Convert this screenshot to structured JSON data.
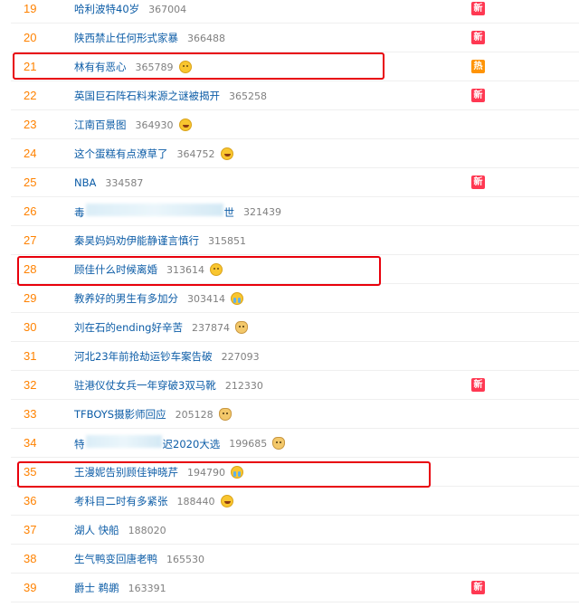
{
  "rows": [
    {
      "rank": "19",
      "title": "哈利波特40岁",
      "count": "367004",
      "emoji": "",
      "badge": "新"
    },
    {
      "rank": "20",
      "title": "陕西禁止任何形式家暴",
      "count": "366488",
      "emoji": "",
      "badge": "新"
    },
    {
      "rank": "21",
      "title": "林有有恶心",
      "count": "365789",
      "emoji": "face",
      "badge": "热"
    },
    {
      "rank": "22",
      "title": "英国巨石阵石料来源之谜被揭开",
      "count": "365258",
      "emoji": "",
      "badge": "新"
    },
    {
      "rank": "23",
      "title": "江南百景图",
      "count": "364930",
      "emoji": "laugh",
      "badge": ""
    },
    {
      "rank": "24",
      "title": "这个蛋糕有点潦草了",
      "count": "364752",
      "emoji": "laugh",
      "badge": ""
    },
    {
      "rank": "25",
      "title": "NBA",
      "count": "334587",
      "emoji": "",
      "badge": "新"
    },
    {
      "rank": "26",
      "title_prefix": "毒",
      "title_suffix": "世",
      "count": "321439",
      "emoji": "",
      "badge": ""
    },
    {
      "rank": "27",
      "title": "秦昊妈妈劝伊能静谨言慎行",
      "count": "315851",
      "emoji": "",
      "badge": ""
    },
    {
      "rank": "28",
      "title": "顾佳什么时候离婚",
      "count": "313614",
      "emoji": "face",
      "badge": ""
    },
    {
      "rank": "29",
      "title": "教养好的男生有多加分",
      "count": "303414",
      "emoji": "cry",
      "badge": ""
    },
    {
      "rank": "30",
      "title": "刘在石的ending好辛苦",
      "count": "237874",
      "emoji": "doge",
      "badge": ""
    },
    {
      "rank": "31",
      "title": "河北23年前抢劫运钞车案告破",
      "count": "227093",
      "emoji": "",
      "badge": ""
    },
    {
      "rank": "32",
      "title": "驻港仪仗女兵一年穿破3双马靴",
      "count": "212330",
      "emoji": "",
      "badge": "新"
    },
    {
      "rank": "33",
      "title": "TFBOYS摄影师回应",
      "count": "205128",
      "emoji": "doge",
      "badge": ""
    },
    {
      "rank": "34",
      "title_prefix": "特",
      "title_suffix": "迟2020大选",
      "count": "199685",
      "emoji": "doge",
      "badge": ""
    },
    {
      "rank": "35",
      "title": "王漫妮告别顾佳钟晓芹",
      "count": "194790",
      "emoji": "cry",
      "badge": ""
    },
    {
      "rank": "36",
      "title": "考科目二时有多紧张",
      "count": "188440",
      "emoji": "laugh",
      "badge": ""
    },
    {
      "rank": "37",
      "title": "湖人 快船",
      "count": "188020",
      "emoji": "",
      "badge": ""
    },
    {
      "rank": "38",
      "title": "生气鸭变回唐老鸭",
      "count": "165530",
      "emoji": "",
      "badge": ""
    },
    {
      "rank": "39",
      "title": "爵士 鹈鹕",
      "count": "163391",
      "emoji": "",
      "badge": "新"
    }
  ],
  "colors": {
    "rank": "#ff8200",
    "link": "#0d5da7",
    "new_badge": "#ff3852",
    "hot_badge": "#ff9406",
    "highlight": "#e8000b"
  }
}
